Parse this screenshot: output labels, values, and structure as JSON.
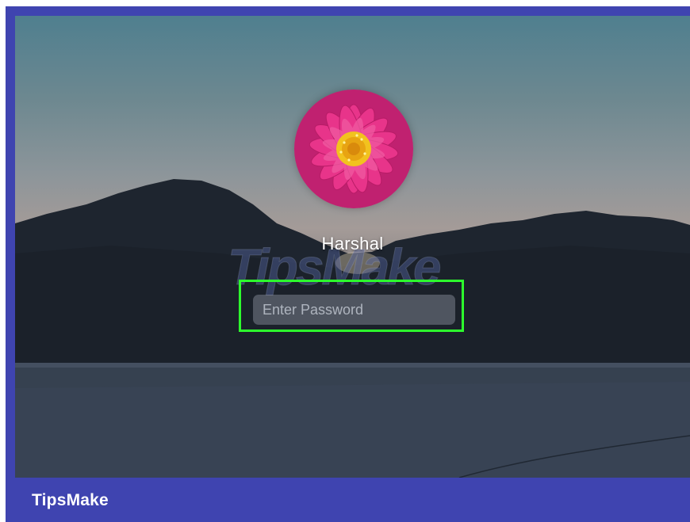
{
  "login": {
    "username": "Harshal",
    "password_placeholder": "Enter Password",
    "password_value": ""
  },
  "watermark": {
    "text": "TipsMake"
  },
  "footer": {
    "brand": "TipsMake"
  },
  "icons": {
    "avatar": "pink-flower-avatar-icon"
  },
  "colors": {
    "frame": "#3f44b0",
    "highlight": "#2dff2d",
    "petal": "#e8348a",
    "flower_center": "#f2c21e"
  }
}
